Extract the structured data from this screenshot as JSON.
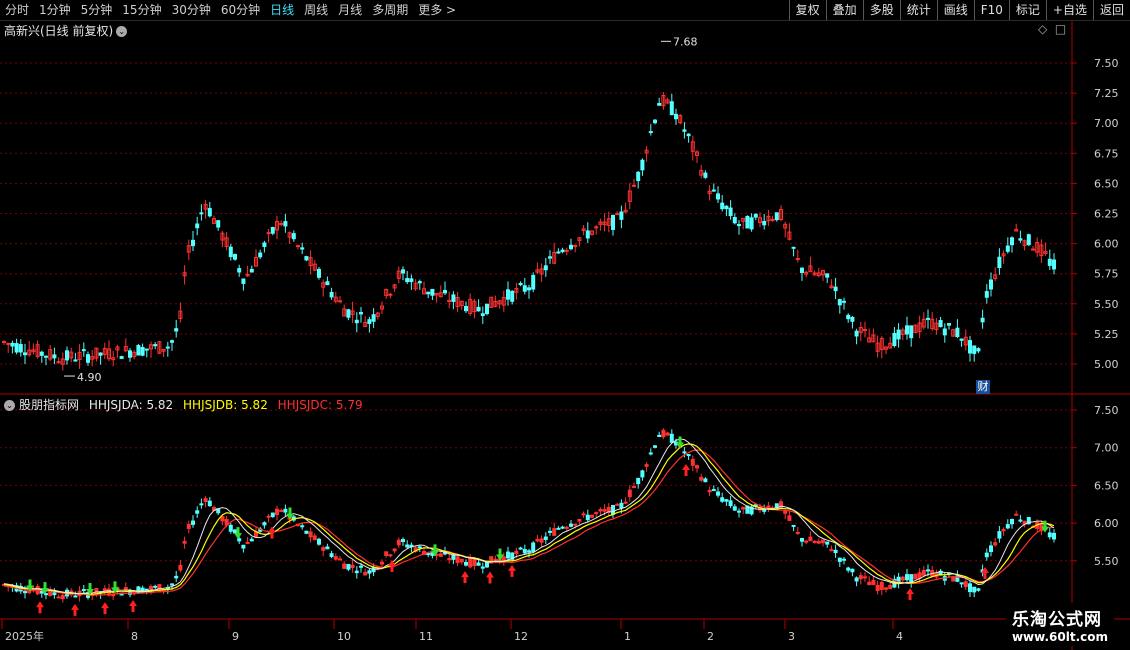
{
  "toolbar": {
    "periods": [
      "分时",
      "1分钟",
      "5分钟",
      "15分钟",
      "30分钟",
      "60分钟",
      "日线",
      "周线",
      "月线",
      "多周期",
      "更多 >"
    ],
    "active_index": 6,
    "buttons": [
      "复权",
      "叠加",
      "多股",
      "统计",
      "画线",
      "F10",
      "标记",
      "+自选",
      "返回"
    ]
  },
  "main_chart": {
    "title": "高新兴(日线 前复权)",
    "y_ticks": [
      "7.50",
      "7.25",
      "7.00",
      "6.75",
      "6.50",
      "6.25",
      "6.00",
      "5.75",
      "5.50",
      "5.25",
      "5.00"
    ],
    "max_label": "7.68",
    "min_label": "4.90",
    "marker": "财"
  },
  "indicator": {
    "name": "股朋指标网",
    "lines": [
      {
        "label": "HHJSJDA: 5.82",
        "color": "#e8e8e8"
      },
      {
        "label": "HHJSJDB: 5.82",
        "color": "#ffff00"
      },
      {
        "label": "HHJSJDC: 5.79",
        "color": "#ff3030"
      }
    ],
    "y_ticks": [
      "7.50",
      "7.00",
      "6.50",
      "6.00",
      "5.50"
    ]
  },
  "x_axis": [
    "2025年",
    "8",
    "9",
    "10",
    "11",
    "12",
    "1",
    "2",
    "3",
    "4"
  ],
  "watermark": {
    "line1": "乐淘公式网",
    "line2": "www.60lt.com"
  },
  "colors": {
    "up": "#ff3232",
    "down": "#54ffff",
    "grid": "#7a0000",
    "axis": "#b00000"
  }
}
